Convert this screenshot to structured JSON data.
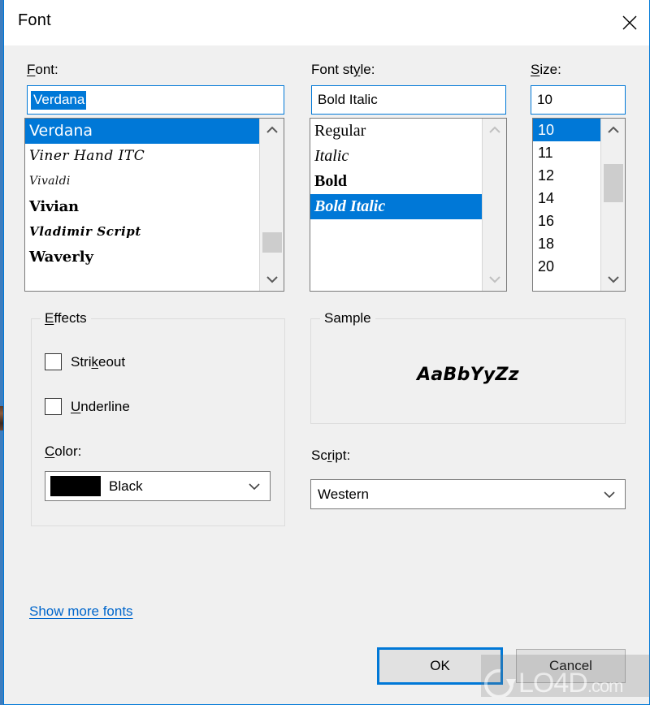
{
  "window": {
    "title": "Font",
    "close_icon": "close-x-icon",
    "border_accent": "#0078d7"
  },
  "colors": {
    "selection": "#0078d7",
    "dialog_face": "#f0f0f0",
    "link": "#0066cc",
    "scroll_thumb": "#cdcdcd",
    "color_swatch": "#000000"
  },
  "font_section": {
    "label": "Font:",
    "label_accel": "F",
    "input_value": "Verdana",
    "input_value_selected": true,
    "items": [
      {
        "name": "Verdana",
        "style_class": "f-verdana",
        "selected": true
      },
      {
        "name": "Viner Hand ITC",
        "style_class": "f-script",
        "selected": false
      },
      {
        "name": "Vivaldi",
        "style_class": "f-script-thin",
        "selected": false
      },
      {
        "name": "Vivian",
        "style_class": "f-slab",
        "selected": false
      },
      {
        "name": "Vladimir Script",
        "style_class": "f-script2",
        "selected": false
      },
      {
        "name": "Waverly",
        "style_class": "f-bold",
        "selected": false
      }
    ],
    "scrollbar": {
      "up_icon": "chevron-up-icon",
      "down_icon": "chevron-down-icon",
      "thumb_top_pct": 72,
      "thumb_height_pct": 16,
      "enabled": true
    }
  },
  "style_section": {
    "label": "Font style:",
    "label_accel": "y",
    "input_value": "Bold Italic",
    "items": [
      {
        "name": "Regular",
        "style_class": "s-regular",
        "selected": false
      },
      {
        "name": "Italic",
        "style_class": "s-italic",
        "selected": false
      },
      {
        "name": "Bold",
        "style_class": "s-bold",
        "selected": false
      },
      {
        "name": "Bold Italic",
        "style_class": "s-bolditalic",
        "selected": true
      }
    ],
    "scrollbar": {
      "up_icon": "chevron-up-icon",
      "down_icon": "chevron-down-icon",
      "enabled": false
    }
  },
  "size_section": {
    "label": "Size:",
    "label_accel": "S",
    "input_value": "10",
    "items": [
      {
        "name": "10",
        "selected": true
      },
      {
        "name": "11",
        "selected": false
      },
      {
        "name": "12",
        "selected": false
      },
      {
        "name": "14",
        "selected": false
      },
      {
        "name": "16",
        "selected": false
      },
      {
        "name": "18",
        "selected": false
      },
      {
        "name": "20",
        "selected": false
      }
    ],
    "scrollbar": {
      "up_icon": "chevron-up-icon",
      "down_icon": "chevron-down-icon",
      "thumb_top_pct": 18,
      "thumb_height_pct": 30,
      "enabled": true
    }
  },
  "effects": {
    "group_title": "Effects",
    "group_title_accel": "E",
    "strikeout": {
      "label": "Strikeout",
      "accel": "k",
      "checked": false
    },
    "underline": {
      "label": "Underline",
      "accel": "U",
      "checked": false
    },
    "color": {
      "label": "Color:",
      "accel": "C",
      "value": "Black",
      "swatch": "#000000",
      "chevron_icon": "chevron-down-icon"
    }
  },
  "sample": {
    "group_title": "Sample",
    "text": "AaBbYyZz"
  },
  "script": {
    "label": "Script:",
    "accel": "r",
    "value": "Western",
    "chevron_icon": "chevron-down-icon"
  },
  "footer": {
    "link": "Show more fonts",
    "ok": "OK",
    "cancel": "Cancel"
  },
  "watermark": {
    "text": "LO4D",
    "suffix": ".com",
    "logo_icon": "refresh-circle-icon"
  }
}
